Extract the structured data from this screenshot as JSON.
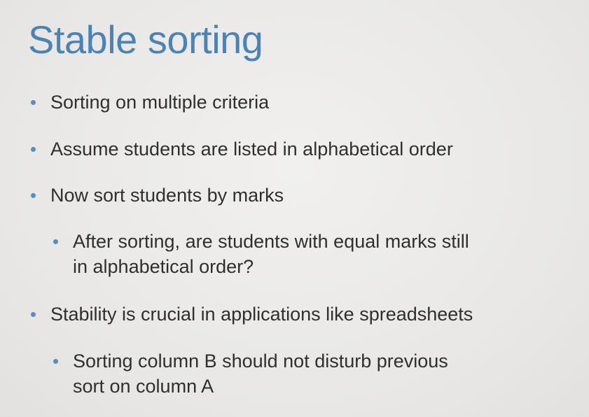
{
  "slide": {
    "title": "Stable sorting",
    "bullets": [
      {
        "level": 1,
        "lines": [
          "Sorting on multiple criteria"
        ]
      },
      {
        "level": 1,
        "lines": [
          "Assume students are listed in alphabetical order"
        ]
      },
      {
        "level": 1,
        "lines": [
          "Now sort students by marks"
        ]
      },
      {
        "level": 2,
        "lines": [
          "After sorting, are students with equal marks still",
          "in alphabetical order?"
        ]
      },
      {
        "level": 1,
        "lines": [
          "Stability is crucial in applications like spreadsheets"
        ]
      },
      {
        "level": 2,
        "lines": [
          "Sorting column B should not disturb previous",
          "sort on column A"
        ]
      }
    ]
  },
  "colors": {
    "title": "#4a84b7",
    "text": "#2f2f2f",
    "bullet_dot": "#5a8dbb",
    "background": "#ecebe9"
  }
}
